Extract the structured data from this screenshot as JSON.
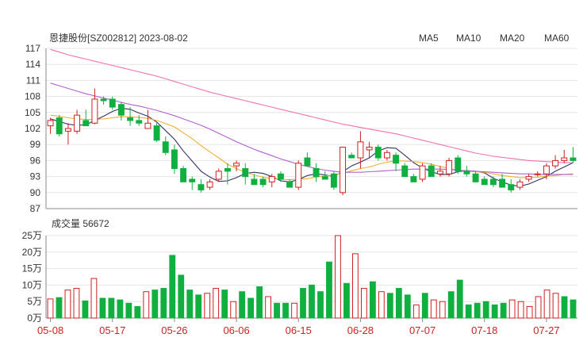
{
  "title": "恩捷股份[SZ002812] 2023-08-02",
  "legend": [
    {
      "label": "MA5",
      "color": "#333366"
    },
    {
      "label": "MA10",
      "color": "#f0b030"
    },
    {
      "label": "MA20",
      "color": "#b060d0"
    },
    {
      "label": "MA60",
      "color": "#f070b0"
    }
  ],
  "volume_label": "成交量 56672",
  "colors": {
    "up": "#d02020",
    "down": "#10b040",
    "grid": "#e6e6e6",
    "axis": "#888888"
  },
  "chart_data": [
    {
      "type": "candlestick",
      "title": "恩捷股份[SZ002812] 2023-08-02",
      "y_ticks": [
        "117",
        "114",
        "111",
        "108",
        "105",
        "102",
        "99",
        "96",
        "93",
        "90",
        "87"
      ],
      "ylim": [
        87,
        117
      ],
      "x_tick_labels": [
        {
          "label": "05-08",
          "index": 0
        },
        {
          "label": "05-17",
          "index": 7
        },
        {
          "label": "05-26",
          "index": 14
        },
        {
          "label": "06-06",
          "index": 21
        },
        {
          "label": "06-15",
          "index": 28
        },
        {
          "label": "06-28",
          "index": 35
        },
        {
          "label": "07-07",
          "index": 42
        },
        {
          "label": "07-18",
          "index": 49
        },
        {
          "label": "07-27",
          "index": 56
        }
      ],
      "ohlc": [
        [
          102.5,
          104.0,
          101.0,
          103.5
        ],
        [
          104.0,
          104.5,
          100.5,
          101.0
        ],
        [
          101.5,
          103.0,
          99.0,
          102.0
        ],
        [
          101.5,
          105.5,
          101.0,
          104.5
        ],
        [
          103.5,
          105.5,
          102.5,
          102.5
        ],
        [
          103.0,
          109.5,
          102.8,
          107.5
        ],
        [
          107.5,
          108.0,
          106.5,
          107.2
        ],
        [
          107.5,
          108.0,
          105.5,
          106.0
        ],
        [
          106.5,
          107.0,
          103.5,
          104.5
        ],
        [
          104.0,
          106.0,
          102.5,
          103.5
        ],
        [
          103.5,
          104.5,
          102.5,
          103.0
        ],
        [
          102.0,
          105.5,
          102.0,
          103.0
        ],
        [
          102.5,
          103.0,
          99.5,
          99.8
        ],
        [
          99.5,
          100.5,
          97.0,
          97.5
        ],
        [
          98.0,
          99.0,
          93.5,
          94.5
        ],
        [
          94.5,
          95.0,
          92.0,
          92.0
        ],
        [
          92.5,
          93.0,
          90.5,
          92.0
        ],
        [
          91.5,
          92.5,
          90.0,
          90.5
        ],
        [
          91.0,
          92.5,
          90.5,
          92.0
        ],
        [
          92.5,
          94.5,
          92.0,
          94.0
        ],
        [
          94.5,
          95.5,
          91.5,
          94.0
        ],
        [
          95.0,
          96.0,
          94.0,
          95.5
        ],
        [
          94.5,
          95.5,
          91.5,
          93.0
        ],
        [
          92.5,
          93.5,
          91.5,
          91.5
        ],
        [
          92.5,
          93.0,
          91.0,
          91.5
        ],
        [
          92.0,
          93.5,
          91.0,
          93.0
        ],
        [
          93.5,
          94.0,
          92.0,
          92.5
        ],
        [
          92.0,
          92.5,
          91.0,
          91.0
        ],
        [
          91.0,
          96.0,
          90.5,
          95.5
        ],
        [
          96.5,
          97.5,
          95.0,
          95.0
        ],
        [
          94.5,
          95.5,
          92.0,
          93.0
        ],
        [
          93.0,
          94.0,
          92.5,
          92.5
        ],
        [
          93.5,
          94.0,
          90.5,
          91.0
        ],
        [
          90.0,
          98.5,
          89.5,
          98.5
        ],
        [
          97.0,
          97.5,
          96.5,
          96.5
        ],
        [
          96.5,
          101.5,
          94.5,
          99.5
        ],
        [
          98.0,
          99.5,
          96.5,
          98.5
        ],
        [
          98.5,
          99.0,
          96.0,
          96.5
        ],
        [
          96.5,
          98.0,
          96.0,
          97.5
        ],
        [
          97.0,
          97.5,
          94.0,
          95.5
        ],
        [
          95.0,
          95.5,
          93.0,
          93.0
        ],
        [
          93.0,
          93.5,
          92.0,
          92.0
        ],
        [
          92.5,
          95.5,
          92.0,
          95.0
        ],
        [
          95.0,
          95.5,
          93.0,
          93.0
        ],
        [
          93.5,
          95.0,
          93.0,
          94.0
        ],
        [
          93.5,
          96.5,
          93.0,
          96.0
        ],
        [
          96.5,
          97.0,
          93.5,
          94.0
        ],
        [
          94.0,
          95.0,
          93.0,
          93.5
        ],
        [
          93.5,
          94.0,
          92.0,
          92.0
        ],
        [
          92.5,
          93.0,
          91.5,
          91.5
        ],
        [
          92.5,
          93.0,
          91.0,
          91.5
        ],
        [
          92.5,
          93.5,
          91.0,
          91.0
        ],
        [
          91.5,
          92.5,
          90.0,
          90.5
        ],
        [
          91.0,
          92.5,
          90.5,
          92.0
        ],
        [
          92.5,
          93.5,
          92.0,
          93.0
        ],
        [
          93.5,
          94.0,
          93.0,
          93.5
        ],
        [
          93.5,
          95.5,
          92.5,
          95.0
        ],
        [
          95.0,
          97.0,
          94.5,
          96.0
        ],
        [
          96.0,
          98.0,
          95.5,
          96.5
        ],
        [
          96.5,
          98.5,
          95.5,
          96.0
        ]
      ],
      "ma": {
        "MA5": [
          103.8,
          103.3,
          102.8,
          102.6,
          102.7,
          103.5,
          104.3,
          105.2,
          105.8,
          105.6,
          104.9,
          104.3,
          103.2,
          101.6,
          100.0,
          97.8,
          95.9,
          94.0,
          92.9,
          92.1,
          92.2,
          92.8,
          93.6,
          93.8,
          93.6,
          93.0,
          92.2,
          92.0,
          92.4,
          93.2,
          93.5,
          93.3,
          93.0,
          93.9,
          95.0,
          95.7,
          96.5,
          97.8,
          98.4,
          98.3,
          97.0,
          95.6,
          94.6,
          93.9,
          93.4,
          93.4,
          93.9,
          94.1,
          94.0,
          93.7,
          92.7,
          92.0,
          91.4,
          91.2,
          91.6,
          92.3,
          93.0,
          94.0,
          94.8,
          95.6
        ],
        "MA10": [
          104.5,
          104.3,
          104.0,
          103.8,
          103.7,
          103.7,
          103.8,
          104.0,
          104.2,
          104.2,
          104.1,
          103.9,
          103.5,
          102.9,
          102.3,
          101.2,
          100.1,
          98.8,
          97.6,
          96.5,
          95.3,
          94.5,
          93.8,
          93.3,
          92.9,
          92.6,
          92.5,
          92.4,
          92.5,
          92.6,
          92.9,
          93.1,
          93.3,
          93.6,
          94.1,
          94.5,
          94.8,
          95.3,
          95.7,
          96.0,
          95.9,
          95.8,
          95.6,
          95.3,
          94.9,
          94.5,
          94.2,
          94.0,
          93.9,
          93.8,
          93.5,
          93.2,
          93.0,
          92.8,
          92.8,
          92.9,
          93.1,
          93.2,
          93.4,
          93.5
        ],
        "MA20": [
          110.5,
          110.0,
          109.5,
          109.0,
          108.5,
          108.1,
          107.7,
          107.3,
          106.9,
          106.5,
          106.2,
          105.8,
          105.4,
          104.9,
          104.4,
          103.8,
          103.2,
          102.6,
          101.9,
          101.1,
          100.3,
          99.5,
          98.8,
          98.1,
          97.5,
          96.9,
          96.3,
          95.8,
          95.3,
          94.9,
          94.5,
          94.2,
          94.0,
          93.8,
          93.8,
          93.8,
          93.9,
          94.0,
          94.1,
          94.2,
          94.3,
          94.4,
          94.4,
          94.4,
          94.4,
          94.3,
          94.2,
          94.1,
          94.0,
          93.9,
          93.8,
          93.7,
          93.6,
          93.5,
          93.5,
          93.4,
          93.4,
          93.4,
          93.4,
          93.4
        ],
        "MA60": [
          116.8,
          116.3,
          115.8,
          115.4,
          115.0,
          114.6,
          114.2,
          113.8,
          113.4,
          113.0,
          112.6,
          112.2,
          111.8,
          111.3,
          110.8,
          110.3,
          109.8,
          109.3,
          108.8,
          108.4,
          108.0,
          107.6,
          107.2,
          106.8,
          106.4,
          106.0,
          105.6,
          105.2,
          104.8,
          104.4,
          104.0,
          103.6,
          103.2,
          102.8,
          102.5,
          102.2,
          101.9,
          101.6,
          101.3,
          101.0,
          100.6,
          100.2,
          99.8,
          99.4,
          99.0,
          98.6,
          98.2,
          97.8,
          97.4,
          97.1,
          96.8,
          96.6,
          96.4,
          96.2,
          96.0,
          95.9,
          95.8,
          95.7,
          95.6,
          95.6
        ]
      }
    },
    {
      "type": "bar",
      "title": "成交量 56672",
      "y_ticks": [
        "25万",
        "20万",
        "15万",
        "10万",
        "5万",
        "0万"
      ],
      "ylim": [
        0,
        25
      ],
      "unit": "万",
      "values": [
        5.8,
        6.2,
        8.5,
        9.0,
        5.2,
        12.0,
        6.0,
        6.0,
        5.5,
        4.5,
        3.5,
        8.0,
        8.5,
        9.0,
        19.0,
        13.0,
        8.5,
        7.0,
        7.5,
        9.0,
        8.5,
        5.0,
        8.0,
        6.0,
        9.5,
        6.5,
        4.5,
        4.5,
        4.5,
        9.0,
        10.0,
        8.0,
        17.0,
        25.0,
        10.5,
        19.5,
        9.0,
        11.0,
        8.0,
        7.5,
        9.0,
        7.0,
        4.0,
        7.5,
        5.5,
        5.0,
        8.0,
        11.5,
        4.0,
        4.5,
        5.0,
        4.0,
        4.5,
        5.5,
        5.0,
        3.5,
        6.5,
        8.5,
        7.5,
        6.5,
        5.5
      ]
    }
  ]
}
